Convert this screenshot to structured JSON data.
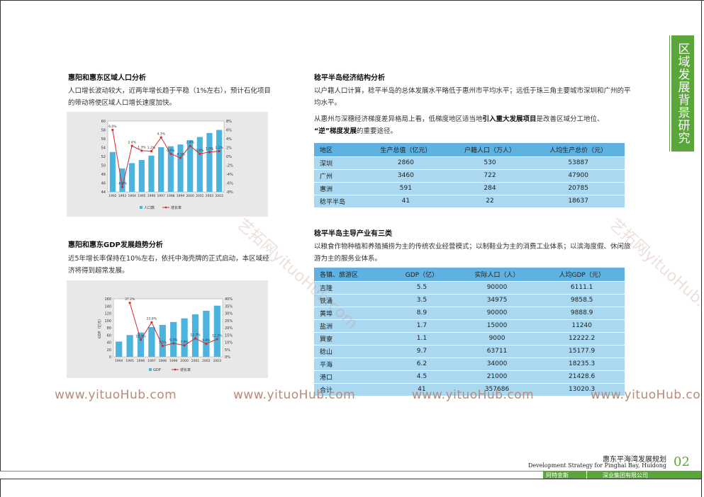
{
  "side_title": "区域发展背景研究",
  "left": {
    "pop_title": "惠阳和惠东区域人口分析",
    "pop_para": "人口增长波动较大，近两年增长趋于平稳（1%左右），预计石化项目的带动将使区域人口增长速度加快。",
    "gdp_title": "惠阳和惠东GDP发展趋势分析",
    "gdp_para": "近5年增长率保持在10%左右，依托中海壳牌的正式启动，本区域经济将得到超常发展。"
  },
  "chart_data": [
    {
      "type": "bar+line",
      "categories": [
        "1992",
        "1993",
        "1994",
        "1995",
        "1996",
        "1997",
        "1998",
        "1999",
        "2000",
        "2001",
        "2002",
        "2003"
      ],
      "series": [
        {
          "name": "人口数",
          "type": "bar",
          "axis": "left",
          "values": [
            53,
            49.3,
            50.5,
            51.2,
            52.2,
            54.1,
            54.3,
            54.7,
            55.7,
            56.4,
            57.3,
            58
          ]
        },
        {
          "name": "增长率",
          "type": "line",
          "axis": "right",
          "values": [
            6.0,
            -6.9,
            2.4,
            1.3,
            1.2,
            4.3,
            0.6,
            -0.3,
            2.4,
            0.6,
            1.0,
            1.2
          ]
        }
      ],
      "point_labels": [
        "6.0%",
        "-6.9%",
        "2.4%",
        "1.3%",
        "1.2%",
        "4.3%",
        "0.6%",
        "-0.3%",
        "2.4%",
        "0.6%",
        "1.0%",
        "1.2%"
      ],
      "ylim_left": [
        44,
        60
      ],
      "yticks_left": [
        "60",
        "58",
        "56",
        "54",
        "52",
        "50",
        "48",
        "46",
        "44"
      ],
      "ylim_right": [
        -8,
        8
      ],
      "yticks_right": [
        "8%",
        "6%",
        "4%",
        "2%",
        "0%",
        "-2%",
        "-4%",
        "-6%",
        "-8%"
      ],
      "legend": [
        "人口数",
        "增长率"
      ],
      "colors": {
        "bar": "#4cb4dc",
        "line": "#d62b2b"
      }
    },
    {
      "type": "bar+line",
      "categories": [
        "1994",
        "1995",
        "1996",
        "1997",
        "1998",
        "1999",
        "2000",
        "2001",
        "2002",
        "2003"
      ],
      "series": [
        {
          "name": "GDP",
          "type": "bar",
          "axis": "left",
          "values": [
            42,
            60,
            67,
            82,
            88,
            96,
            106,
            117,
            127,
            141
          ]
        },
        {
          "name": "增长率",
          "type": "line",
          "axis": "right",
          "values": [
            null,
            37.2,
            11.7,
            23.8,
            7.5,
            9.3,
            7.9,
            12.7,
            9.0,
            12.2
          ]
        }
      ],
      "point_labels": [
        "",
        "37.2%",
        "11.7%",
        "23.8%",
        "7.5%",
        "9.3%",
        "7.9%",
        "12.7%",
        "9.0%",
        "12.2%"
      ],
      "ylabel": "GDP（亿元）",
      "ylim_left": [
        0,
        160
      ],
      "yticks_left": [
        "160",
        "140",
        "120",
        "100",
        "80",
        "60",
        "40",
        "20",
        "0"
      ],
      "ylim_right": [
        0,
        40
      ],
      "yticks_right": [
        "40%",
        "35%",
        "30%",
        "25%",
        "20%",
        "15%",
        "10%",
        "5%",
        "0%"
      ],
      "legend": [
        "GDP",
        "增长率"
      ],
      "colors": {
        "bar": "#4cb4dc",
        "line": "#d62b2b"
      }
    }
  ],
  "right": {
    "econ_title": "稔平半岛经济结构分析",
    "econ_para1": "以户籍人口计算，稔平半岛的总体发展水平略低于惠州市平均水平；远低于珠三角主要城市深圳和广州的平均水平。",
    "econ_para2_a": "从惠州与深穗经济梯度差异格局上看，低梯度地区适当地",
    "econ_para2_b": "引入重大发展项目",
    "econ_para2_c": "是改善区域分工地位、",
    "econ_para2_d": "“逆”梯度发展",
    "econ_para2_e": "的重要途径。",
    "table1": {
      "headers": [
        "地区",
        "生产总值（亿元）",
        "户籍人口（万人）",
        "人均生产总价（元）"
      ],
      "rows": [
        [
          "深圳",
          "2860",
          "530",
          "53887"
        ],
        [
          "广州",
          "3460",
          "722",
          "47900"
        ],
        [
          "惠洲",
          "591",
          "284",
          "20785"
        ],
        [
          "稔平半岛",
          "41",
          "22",
          "18637"
        ]
      ]
    },
    "ind_title": "稔平半岛主导产业有三类",
    "ind_para": "以粮食作物种植和养殖捕捞为主的传统农业经营模式；以制鞋业为主的消费工业体系；以滨海度假、休闲旅游为主的服务业体系。",
    "table2": {
      "headers": [
        "各镇、旅游区",
        "GDP（亿）",
        "实际人口（人）",
        "人均GDP（元）"
      ],
      "rows": [
        [
          "吉隆",
          "5.5",
          "90000",
          "6111.1"
        ],
        [
          "铁涌",
          "3.5",
          "34975",
          "9858.5"
        ],
        [
          "黄埠",
          "8.9",
          "90000",
          "9888.9"
        ],
        [
          "盐洲",
          "1.7",
          "15000",
          "11240"
        ],
        [
          "巽寮",
          "1.1",
          "9000",
          "12222.2"
        ],
        [
          "稔山",
          "9.7",
          "63711",
          "15177.9"
        ],
        [
          "平海",
          "6.2",
          "34000",
          "18235.3"
        ],
        [
          "港口",
          "4.5",
          "21000",
          "21428.6"
        ],
        [
          "合计",
          "41",
          "357686",
          "13020.3"
        ]
      ]
    }
  },
  "watermarks": [
    "www.yituoHub.com",
    "www.yituoHub.com",
    "www.yituoHub.com",
    "www.yituoHub.co"
  ],
  "diag_watermarks": [
    "艺拓网yituoHub.com",
    "艺拓网yituoHub."
  ],
  "footer": {
    "title_cn": "惠东平海湾发展规划",
    "title_en": "Development Strategy for Pinghai Bay, Huidong",
    "page_num": "02",
    "company1": "阿特金斯",
    "company2": "深业集团有限公司"
  }
}
